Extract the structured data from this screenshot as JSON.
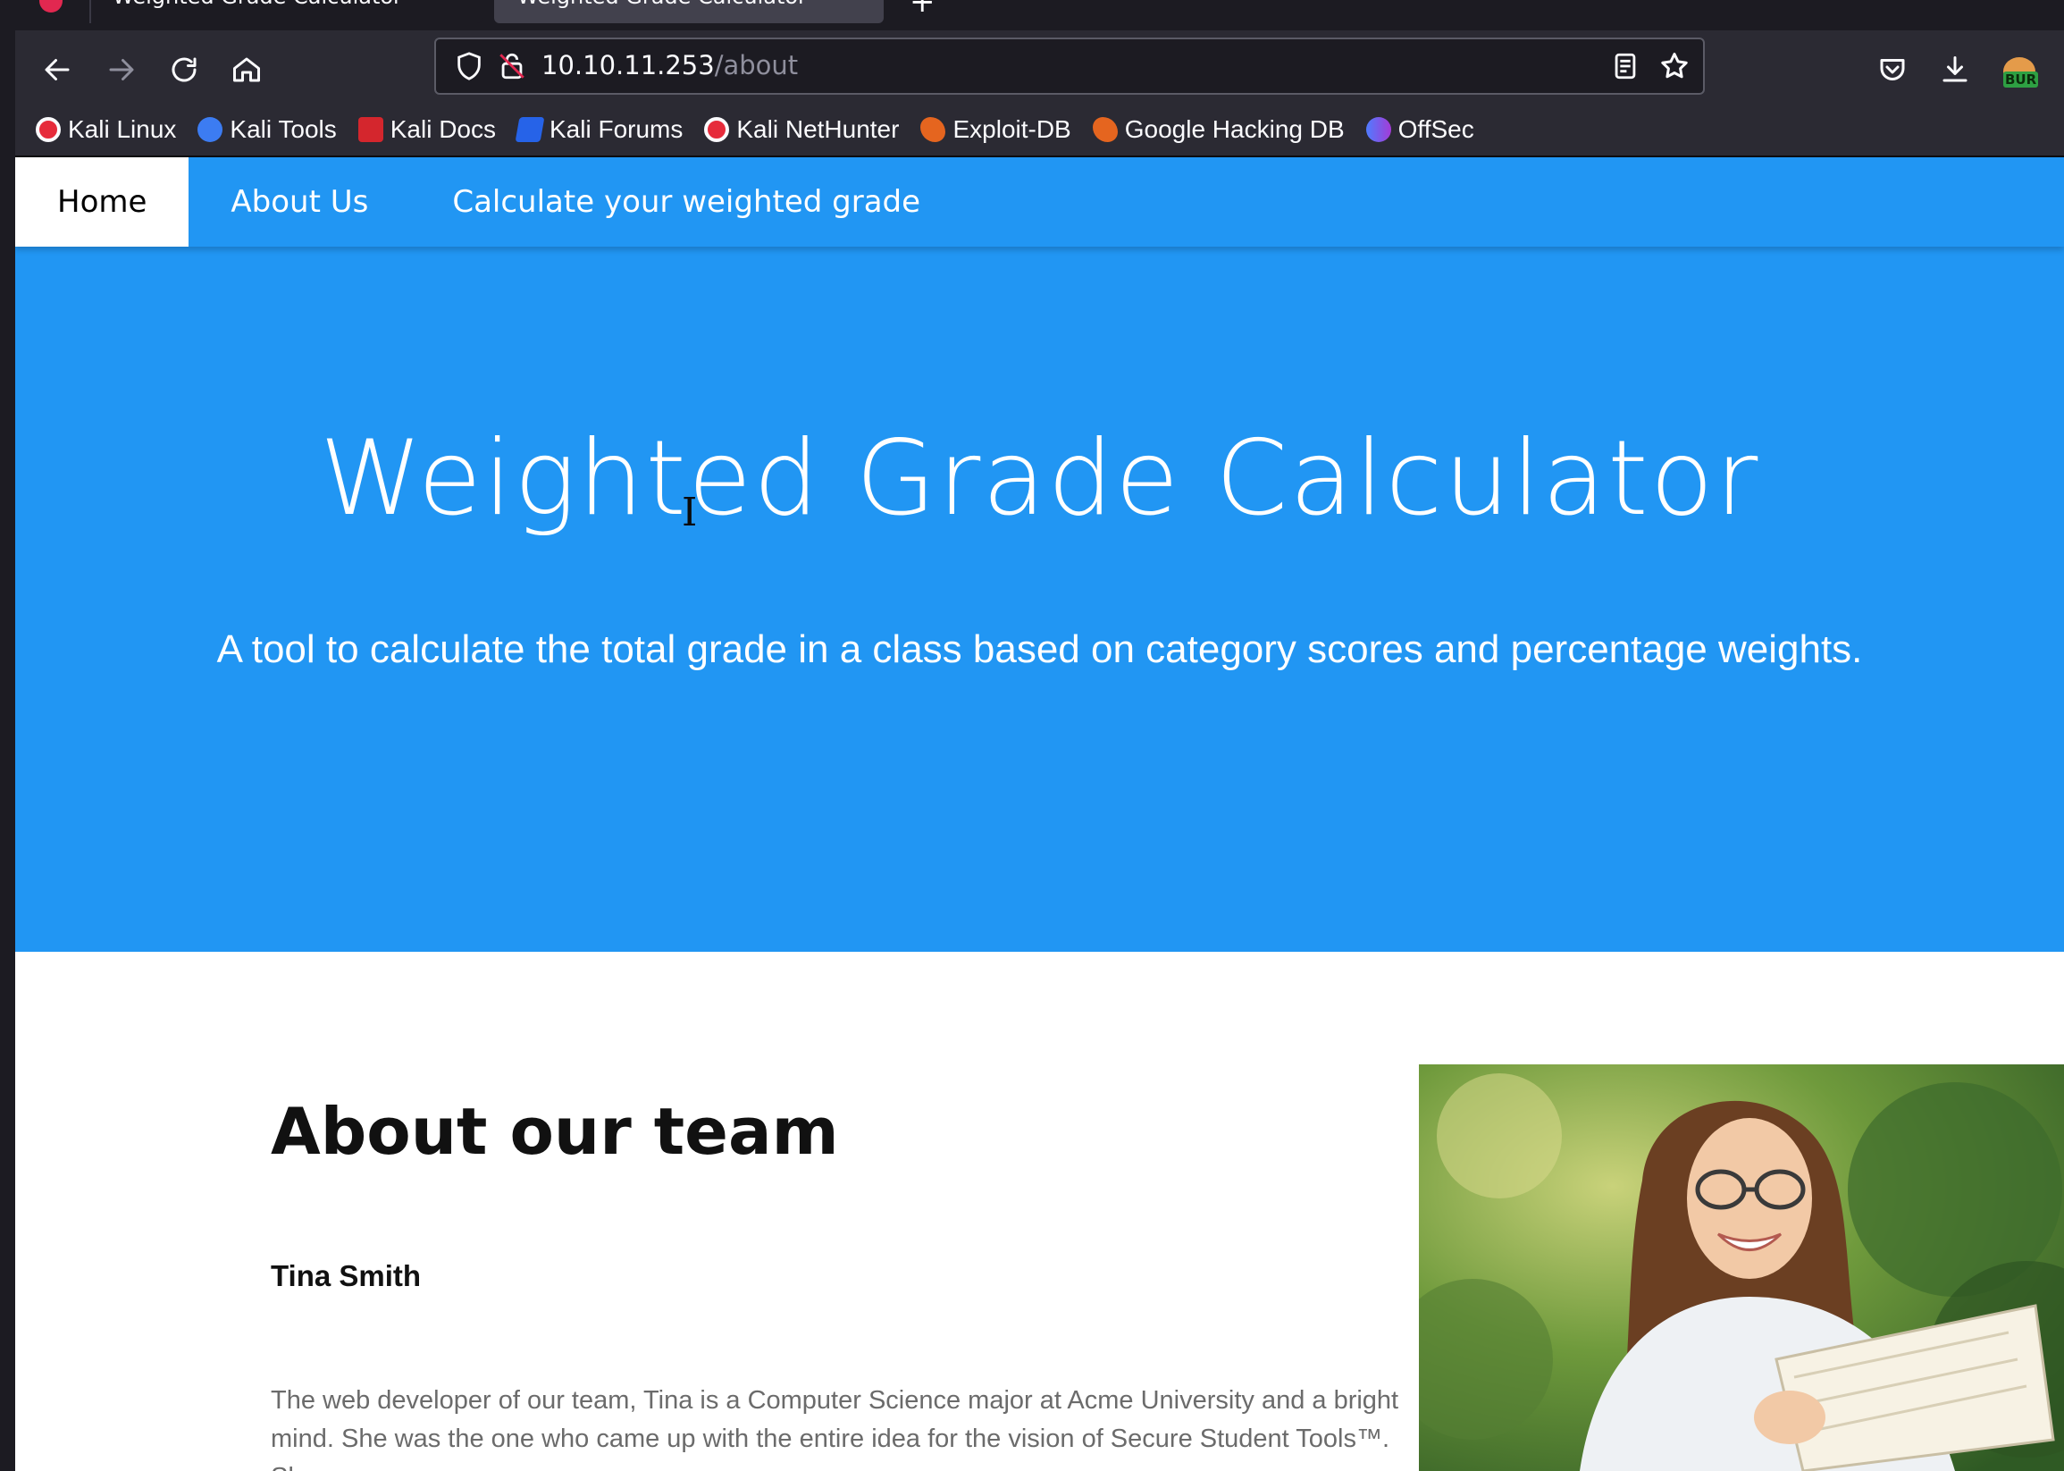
{
  "browser": {
    "tabs": [
      {
        "title": "Weighted Grade Calculator",
        "active": false
      },
      {
        "title": "Weighted Grade Calculator",
        "active": true
      }
    ],
    "url": {
      "host": "10.10.11.253",
      "path": "/about"
    },
    "bookmarks": [
      {
        "label": "Kali Linux",
        "icon": "kali-dragon-icon"
      },
      {
        "label": "Kali Tools",
        "icon": "kali-tools-icon"
      },
      {
        "label": "Kali Docs",
        "icon": "kali-docs-icon"
      },
      {
        "label": "Kali Forums",
        "icon": "kali-forums-icon"
      },
      {
        "label": "Kali NetHunter",
        "icon": "kali-dragon-icon"
      },
      {
        "label": "Exploit-DB",
        "icon": "exploit-db-icon"
      },
      {
        "label": "Google Hacking DB",
        "icon": "exploit-db-icon"
      },
      {
        "label": "OffSec",
        "icon": "offsec-icon"
      }
    ],
    "extension_badge": "BUR"
  },
  "nav": {
    "items": [
      {
        "label": "Home",
        "active": true
      },
      {
        "label": "About Us",
        "active": false
      },
      {
        "label": "Calculate your weighted grade",
        "active": false
      }
    ]
  },
  "hero": {
    "title": "Weighted Grade Calculator",
    "subtitle": "A tool to calculate the total grade in a class based on category scores and percentage weights."
  },
  "about": {
    "title": "About our team",
    "member_name": "Tina Smith",
    "member_bio": "The web developer of our team, Tina is a Computer Science major at Acme University and a bright mind. She was the one who came up with the entire idea for the vision of Secure Student Tools™. She"
  },
  "colors": {
    "brand_blue": "#2196f3",
    "browser_dark": "#2b2a33",
    "tab_active": "#42414d"
  }
}
